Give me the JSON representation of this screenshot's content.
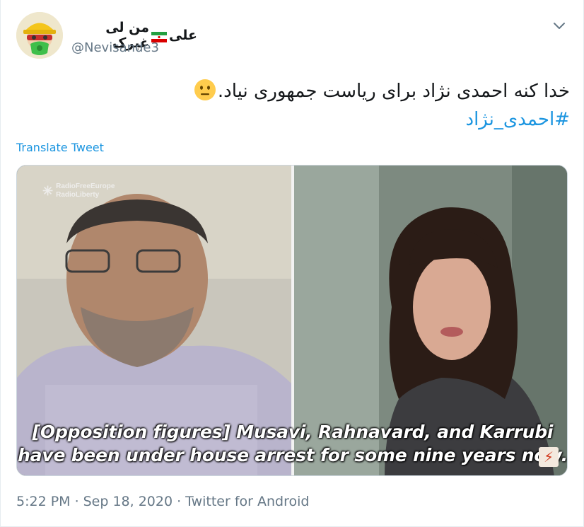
{
  "author": {
    "name_part1": "علی",
    "name_part2": "من لی غیرک",
    "flag": "iran-flag",
    "handle": "@Nevisande3",
    "avatar": "avatar-cartoon-hardhat-mask"
  },
  "menu": {
    "icon": "chevron-down-icon"
  },
  "tweet": {
    "text": "خدا کنه احمدی نژاد برای ریاست جمهوری نیاد.",
    "emoji": "neutral-face-emoji",
    "hashtag": "#احمدی_نژاد",
    "translate_label": "Translate Tweet"
  },
  "media": {
    "logo_line1": "RadioFreeEurope",
    "logo_line2": "RadioLiberty",
    "caption_line1": "[Opposition figures] Musavi, Rahnavard, and Karrubi",
    "caption_line2": "have been under house arrest for some nine years now."
  },
  "meta": {
    "time": "5:22 PM",
    "date": "Sep 18, 2020",
    "separator": "·",
    "source": "Twitter for Android"
  },
  "colors": {
    "link": "#1b95e0",
    "secondary_text": "#657786",
    "primary_text": "#14171a"
  }
}
